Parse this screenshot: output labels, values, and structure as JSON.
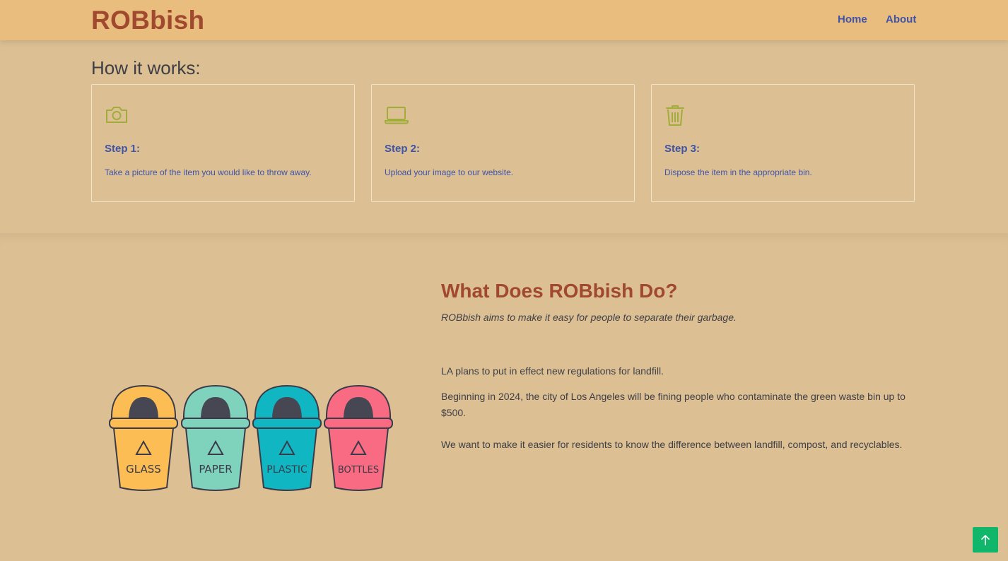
{
  "nav": {
    "brand": "ROBbish",
    "links": [
      "Home",
      "About"
    ]
  },
  "how_it_works": {
    "title": "How it works:",
    "steps": [
      {
        "icon": "camera-icon",
        "title": "Step 1:",
        "text": "Take a picture of the item you would like to throw away."
      },
      {
        "icon": "laptop-icon",
        "title": "Step 2:",
        "text": "Upload your image to our website."
      },
      {
        "icon": "trash-icon",
        "title": "Step 3:",
        "text": "Dispose the item in the appropriate bin."
      }
    ]
  },
  "about": {
    "title": "What Does ROBbish Do?",
    "lead": "ROBbish aims to make it easy for people to separate their garbage.",
    "paragraphs": [
      " LA plans to put in effect new regulations for landfill.",
      " Beginning in 2024, the city of Los Angeles will be fining people who contaminate the green waste bin up to $500.",
      "We want to make it easier for residents to know the difference between landfill, compost, and recyclables."
    ],
    "bins": [
      {
        "label": "GLASS",
        "color": "#fdbd55"
      },
      {
        "label": "PAPER",
        "color": "#7fd3bd"
      },
      {
        "label": "PLASTIC",
        "color": "#10b7c3"
      },
      {
        "label": "BOTTLES",
        "color": "#f86b82"
      }
    ]
  },
  "colors": {
    "background": "#dcbf93",
    "navbar": "#e9bd7e",
    "brand": "#a0492f",
    "link": "#3f54a8",
    "icon": "#a1ad3a",
    "back_to_top": "#10b66a"
  },
  "back_to_top": {
    "icon": "arrow-up-icon"
  }
}
